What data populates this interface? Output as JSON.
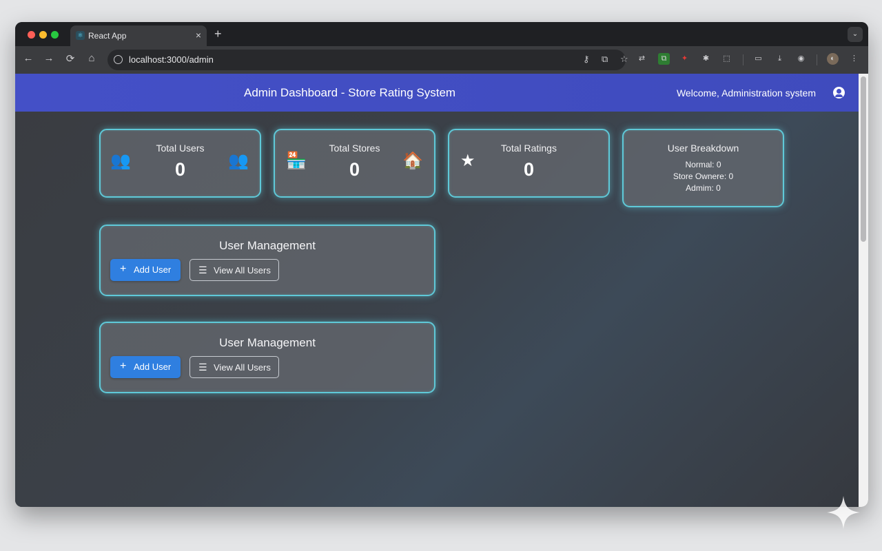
{
  "browser": {
    "tab": {
      "title": "React App",
      "favicon": "react-icon",
      "close": "×"
    },
    "new_tab": "+",
    "tab_menu": "⌄",
    "nav": {
      "back": "←",
      "forward": "→",
      "reload": "⟳",
      "home": "⌂"
    },
    "url": "localhost:3000/admin",
    "omnibox_icons": {
      "key": "⚷",
      "install": "⧉",
      "bookmark": "☆"
    },
    "extensions": [
      "⇄",
      "⧉",
      "✦",
      "✱",
      "⬚",
      "▭",
      "⤓",
      "◉",
      "◐",
      "⋮"
    ]
  },
  "header": {
    "title": "Admin Dashboard - Store Rating System",
    "welcome": "Welcome, Administration system"
  },
  "stats": [
    {
      "label": "Total Users",
      "value": "0",
      "icon_left": "users-icon",
      "icon_right": "users-icon"
    },
    {
      "label": "Total Stores",
      "value": "0",
      "icon_left": "store-icon",
      "icon_right": "house-icon"
    },
    {
      "label": "Total Ratings",
      "value": "0",
      "icon_left": "star-icon"
    }
  ],
  "breakdown": {
    "title": "User Breakdown",
    "lines": [
      "Normal: 0",
      "Store Ownere: 0",
      "Admim: 0"
    ]
  },
  "management_cards": [
    {
      "title": "User Management",
      "add_label": "Add User",
      "view_label": "View All Users"
    },
    {
      "title": "User Management",
      "add_label": "Add User",
      "view_label": "View All Users"
    }
  ],
  "glyphs": {
    "users": "👥",
    "store": "🏪",
    "house": "🏠",
    "star": "★",
    "plus": "+",
    "list": "☰"
  },
  "colors": {
    "header": "#4450c7",
    "card_border": "#5fc9d8",
    "primary_button": "#2f7fe0"
  }
}
